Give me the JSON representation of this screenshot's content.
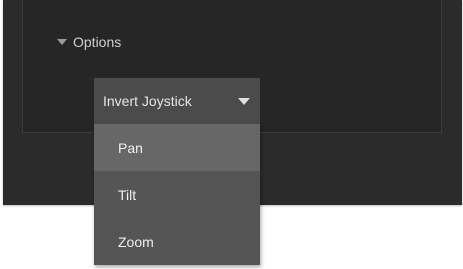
{
  "options": {
    "label": "Options"
  },
  "dropdown": {
    "selected": "Invert Joystick",
    "items": [
      {
        "label": "Pan",
        "highlighted": true
      },
      {
        "label": "Tilt",
        "highlighted": false
      },
      {
        "label": "Zoom",
        "highlighted": false
      }
    ]
  },
  "colors": {
    "panel_bg": "#262626",
    "frame_bg": "#2b2b2b",
    "dropdown_bg": "#4b4b4b",
    "menu_bg": "#555555",
    "menu_highlight": "#676767"
  }
}
